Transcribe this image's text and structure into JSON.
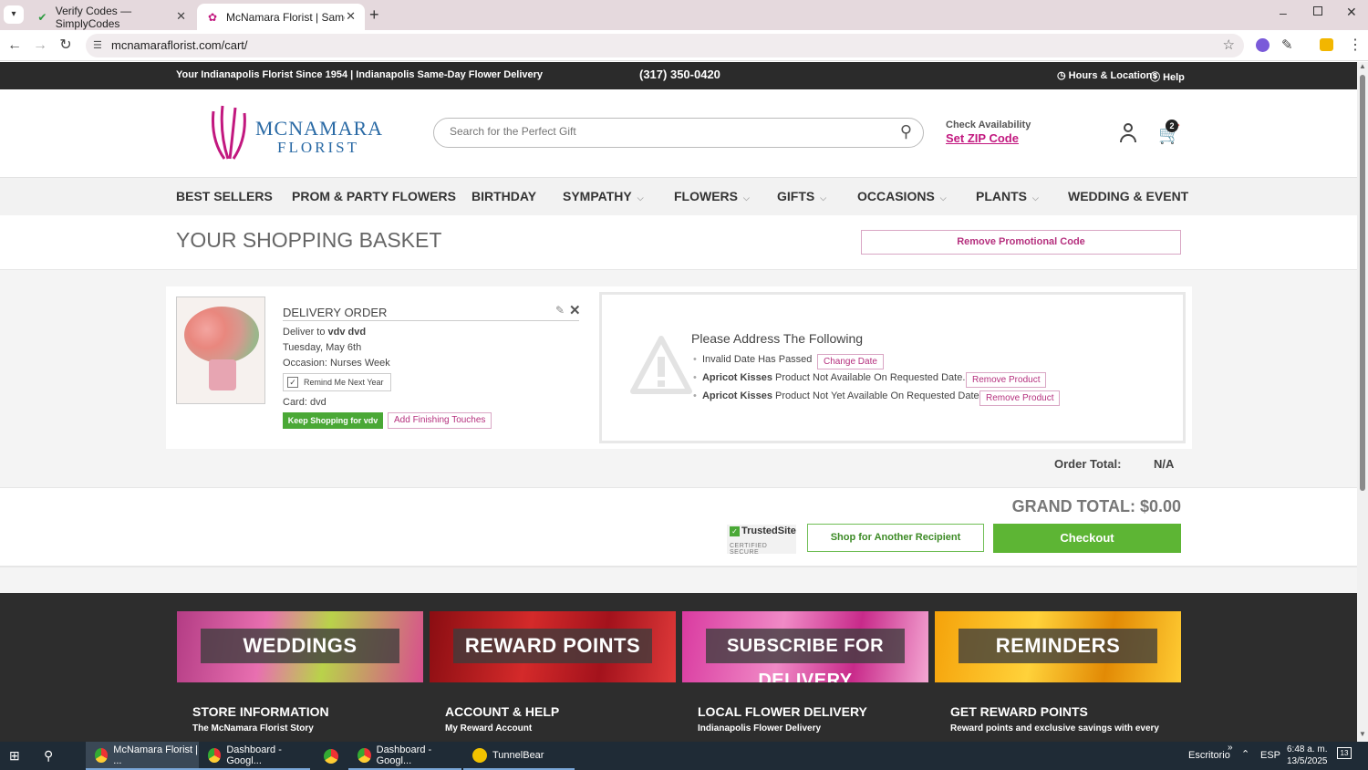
{
  "browser": {
    "tabs": [
      {
        "title": "Verify Codes — SimplyCodes",
        "active": false
      },
      {
        "title": "McNamara Florist | Same Day In",
        "active": true
      }
    ],
    "url": "mcnamaraflorist.com/cart/"
  },
  "site": {
    "topstrip": {
      "tagline": "Your Indianapolis Florist Since 1954 | Indianapolis Same-Day Flower Delivery",
      "phone": "(317) 350-0420",
      "hours": "Hours & Locations",
      "help": "Help"
    },
    "logo": {
      "line1": "McNamara",
      "line2": "FLORIST"
    },
    "search": {
      "placeholder": "Search for the Perfect Gift"
    },
    "availability": {
      "label": "Check Availability",
      "link": "Set ZIP Code"
    },
    "cart_count": "2",
    "nav": [
      "BEST SELLERS",
      "PROM & PARTY FLOWERS",
      "BIRTHDAY",
      "SYMPATHY",
      "FLOWERS",
      "GIFTS",
      "OCCASIONS",
      "PLANTS",
      "WEDDING & EVENT"
    ],
    "page_title": "YOUR SHOPPING BASKET",
    "remove_promo": "Remove Promotional Code",
    "order": {
      "heading": "DELIVERY ORDER",
      "deliver_prefix": "Deliver to ",
      "recipient": "vdv dvd",
      "date": "Tuesday, May 6th",
      "occasion": "Occasion: Nurses Week",
      "remind": "Remind Me Next Year",
      "card": "Card: dvd",
      "keep_shopping": "Keep Shopping for vdv",
      "finishing": "Add Finishing Touches"
    },
    "alert": {
      "title": "Please Address The Following",
      "items": [
        {
          "bold": "",
          "text": "Invalid Date Has Passed",
          "action": "Change Date"
        },
        {
          "bold": "Apricot Kisses",
          "text": " Product Not Available On Requested Date.",
          "action": "Remove Product"
        },
        {
          "bold": "Apricot Kisses",
          "text": " Product Not Yet Available On Requested Date",
          "action": "Remove Product"
        }
      ]
    },
    "order_total": {
      "label": "Order Total:",
      "value": "N/A"
    },
    "grand_total": "GRAND TOTAL: $0.00",
    "trusted": {
      "name": "TrustedSite",
      "sub": "CERTIFIED SECURE"
    },
    "shop_another": "Shop for Another Recipient",
    "checkout": "Checkout",
    "banners": [
      "WEDDINGS",
      "REWARD POINTS",
      "SUBSCRIBE FOR DELIVERY",
      "REMINDERS"
    ],
    "footer_cols": [
      {
        "heading": "STORE INFORMATION",
        "sub": "The McNamara Florist Story"
      },
      {
        "heading": "ACCOUNT & HELP",
        "sub": "My Reward Account"
      },
      {
        "heading": "LOCAL FLOWER DELIVERY",
        "sub": "Indianapolis Flower Delivery"
      },
      {
        "heading": "GET REWARD POINTS",
        "sub": "Reward points and exclusive savings with every"
      }
    ]
  },
  "taskbar": {
    "apps": [
      "McNamara Florist | ...",
      "Dashboard - Googl...",
      "",
      "Dashboard - Googl...",
      "TunnelBear"
    ],
    "desktop": "Escritorio",
    "lang": "ESP",
    "time": "6:48 a. m.",
    "date": "13/5/2025"
  },
  "colors": {
    "brand_pink": "#c2187f",
    "brand_blue": "#2a6aa5",
    "checkout_green": "#5db534",
    "topstrip": "#2b2b2b"
  }
}
